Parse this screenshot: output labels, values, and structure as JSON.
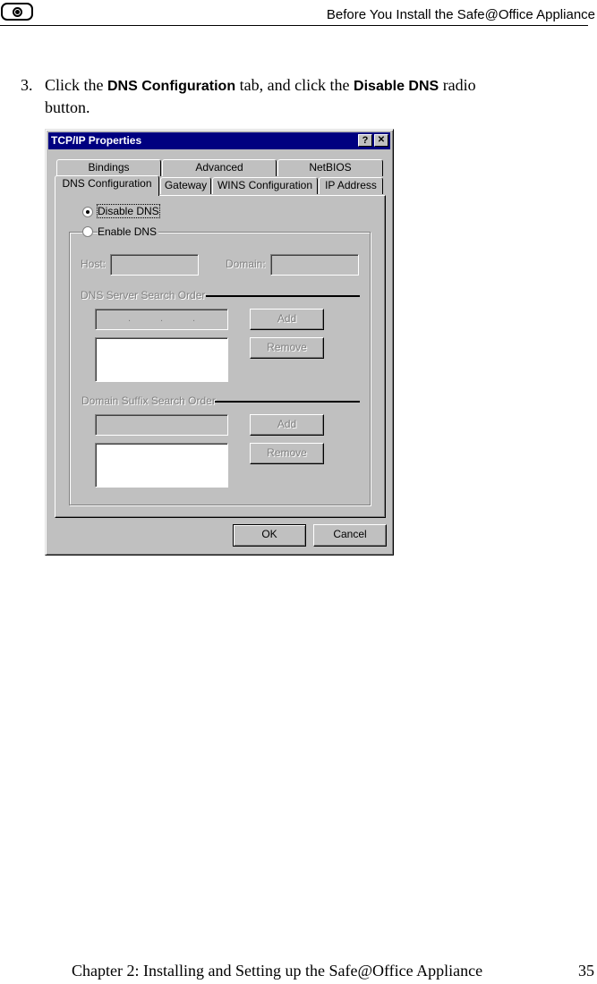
{
  "header": {
    "title": "Before You Install the Safe@Office Appliance"
  },
  "step": {
    "number": "3.",
    "text_before_1": "Click the ",
    "bold_1": "DNS Configuration",
    "text_middle": " tab, and click the ",
    "bold_2": "Disable DNS",
    "text_after": " radio",
    "text_line2": "button."
  },
  "dialog": {
    "title": "TCP/IP Properties",
    "help_button": "?",
    "close_button": "✕",
    "tabs_back": [
      "Bindings",
      "Advanced",
      "NetBIOS"
    ],
    "tabs_front": [
      "DNS Configuration",
      "Gateway",
      "WINS Configuration",
      "IP Address"
    ],
    "disable_dns": "Disable DNS",
    "enable_dns": "Enable DNS",
    "host_label": "Host:",
    "domain_label": "Domain:",
    "dns_server_group": "DNS Server Search Order",
    "domain_suffix_group": "Domain Suffix Search Order",
    "add_label": "Add",
    "remove_label": "Remove",
    "ok_label": "OK",
    "cancel_label": "Cancel"
  },
  "footer": {
    "chapter": "Chapter 2: Installing and Setting up the Safe@Office Appliance",
    "page": "35"
  }
}
